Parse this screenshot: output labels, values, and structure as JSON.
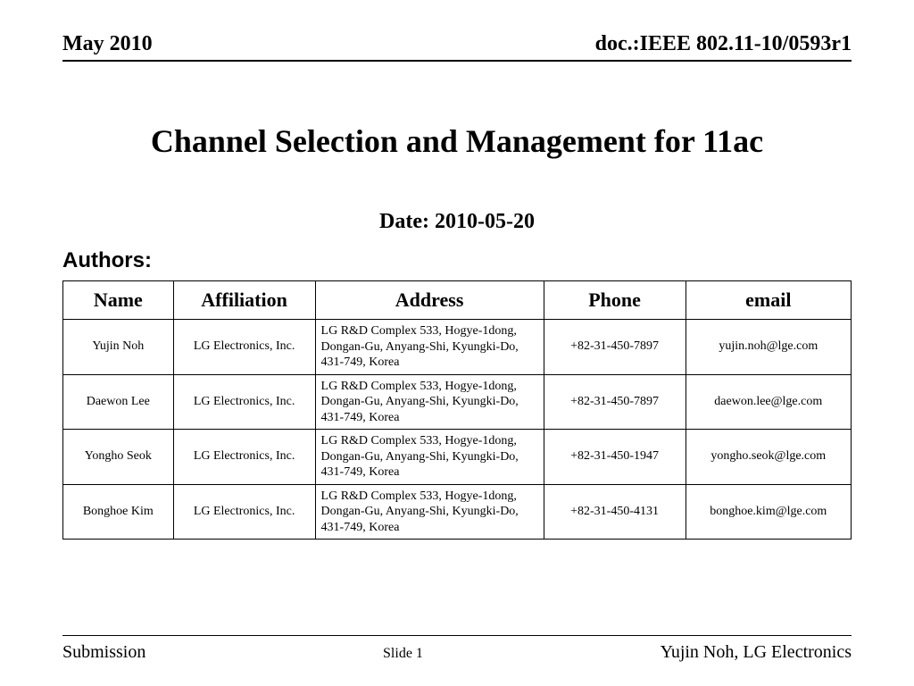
{
  "header": {
    "left": "May 2010",
    "right": "doc.:IEEE 802.11-10/0593r1"
  },
  "title": "Channel Selection and Management for 11ac",
  "date_line": "Date: 2010-05-20",
  "authors_label": "Authors:",
  "columns": {
    "name": "Name",
    "affiliation": "Affiliation",
    "address": "Address",
    "phone": "Phone",
    "email": "email"
  },
  "authors": [
    {
      "name": "Yujin Noh",
      "affiliation": "LG Electronics, Inc.",
      "address": "LG R&D Complex 533, Hogye-1dong, Dongan-Gu, Anyang-Shi, Kyungki-Do, 431-749, Korea",
      "phone": "+82-31-450-7897",
      "email": "yujin.noh@lge.com"
    },
    {
      "name": "Daewon Lee",
      "affiliation": "LG Electronics, Inc.",
      "address": "LG R&D Complex 533, Hogye-1dong, Dongan-Gu, Anyang-Shi, Kyungki-Do, 431-749, Korea",
      "phone": "+82-31-450-7897",
      "email": "daewon.lee@lge.com"
    },
    {
      "name": "Yongho Seok",
      "affiliation": "LG Electronics, Inc.",
      "address": "LG R&D Complex 533, Hogye-1dong, Dongan-Gu, Anyang-Shi, Kyungki-Do, 431-749, Korea",
      "phone": "+82-31-450-1947",
      "email": "yongho.seok@lge.com"
    },
    {
      "name": "Bonghoe Kim",
      "affiliation": "LG Electronics, Inc.",
      "address": "LG R&D Complex 533, Hogye-1dong, Dongan-Gu, Anyang-Shi, Kyungki-Do, 431-749, Korea",
      "phone": "+82-31-450-4131",
      "email": "bonghoe.kim@lge.com"
    }
  ],
  "footer": {
    "left": "Submission",
    "center": "Slide 1",
    "right": "Yujin Noh, LG Electronics"
  }
}
